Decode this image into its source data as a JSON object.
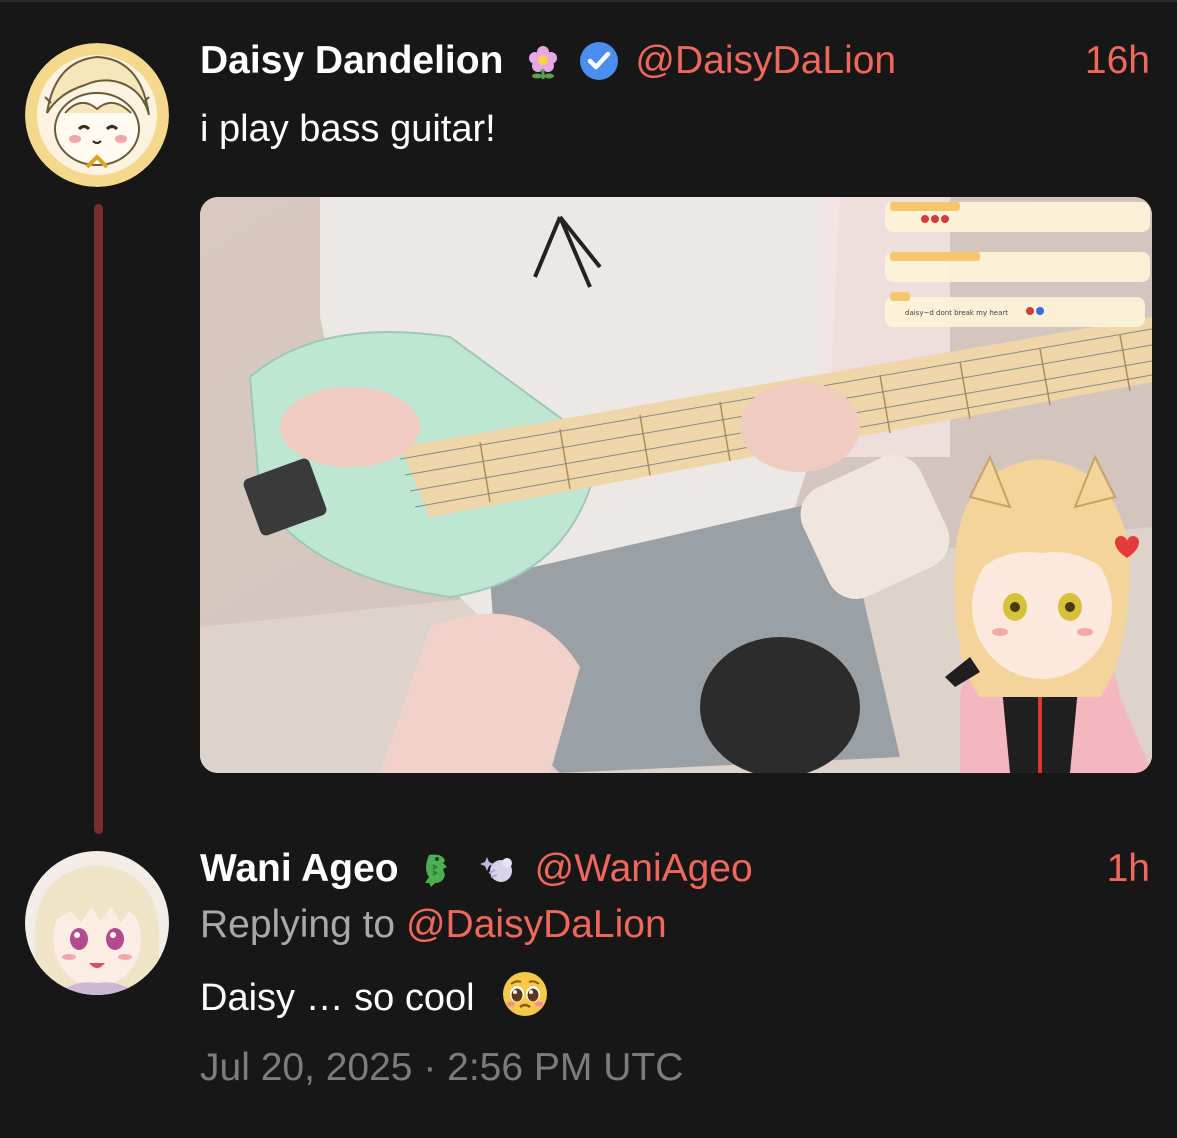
{
  "tweet": {
    "author": {
      "display_name": "Daisy Dandelion",
      "badge_icon": "flower-icon",
      "verified_icon": "verified-check-icon",
      "handle": "@DaisyDaLion"
    },
    "time_ago": "16h",
    "text": "i play bass guitar!",
    "media": {
      "chat_overlay": [
        "daisy~d dont break my heart"
      ]
    }
  },
  "reply": {
    "author": {
      "display_name": "Wani Ageo",
      "badge_icon": "crocodile-icon",
      "second_icon": "sparkle-icon",
      "handle": "@WaniAgeo"
    },
    "time_ago": "1h",
    "replying_prefix": "Replying to",
    "replying_to": "@DaisyDaLion",
    "text": "Daisy … so cool",
    "text_emoji": "pleading-face-icon",
    "timestamp": "Jul 20, 2025 · 2:56 PM UTC"
  },
  "colors": {
    "background": "#171717",
    "accent": "#f0675b",
    "thread_line": "#7a2d2b",
    "muted": "#a9a9a9",
    "verified": "#4a8ef0"
  }
}
